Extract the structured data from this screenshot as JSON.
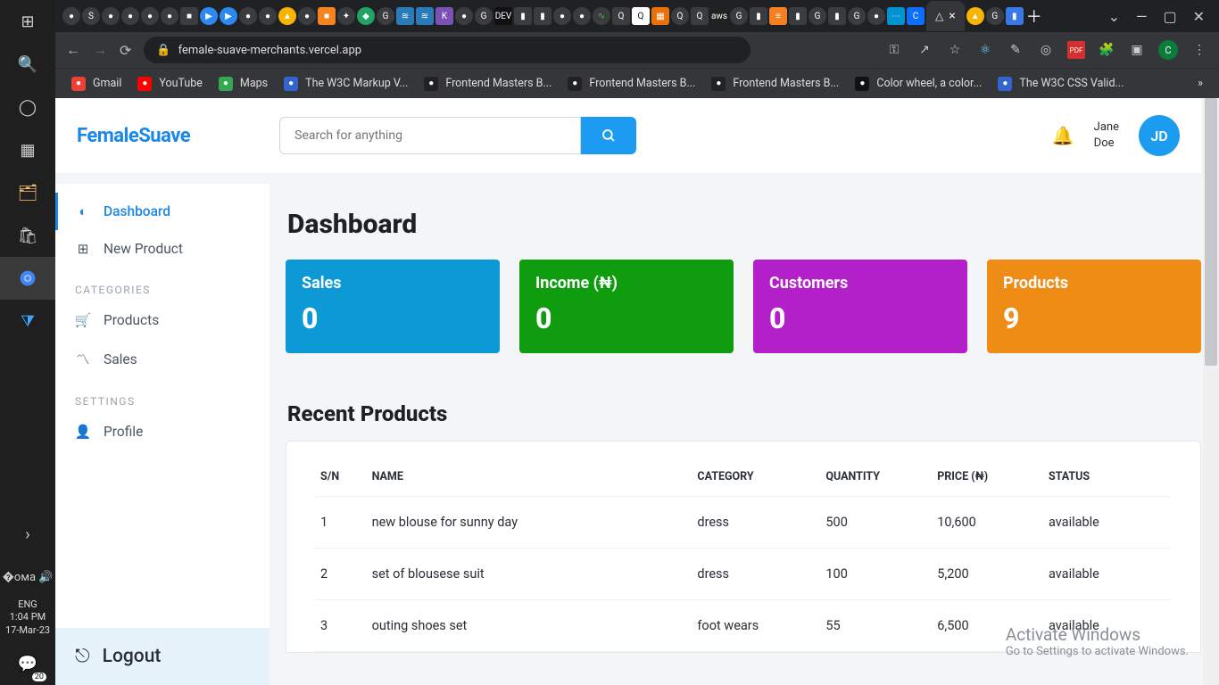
{
  "os": {
    "lang": "ENG",
    "time": "1:04 PM",
    "date": "17-Mar-23",
    "notif_badge": "20"
  },
  "browser": {
    "active_tab_title": "",
    "url": "female-suave-merchants.vercel.app",
    "profile_letter": "C",
    "bookmarks": [
      {
        "label": "Gmail",
        "color": "#ea4335"
      },
      {
        "label": "YouTube",
        "color": "#ff0000"
      },
      {
        "label": "Maps",
        "color": "#34a853"
      },
      {
        "label": "The W3C Markup V...",
        "color": "#3366cc"
      },
      {
        "label": "Frontend Masters B...",
        "color": "#222"
      },
      {
        "label": "Frontend Masters B...",
        "color": "#222"
      },
      {
        "label": "Frontend Masters B...",
        "color": "#222"
      },
      {
        "label": "Color wheel, a color...",
        "color": "#111"
      },
      {
        "label": "The W3C CSS Valid...",
        "color": "#3366cc"
      }
    ]
  },
  "app": {
    "logo": "FemaleSuave",
    "search_placeholder": "Search for anything",
    "user_first": "Jane",
    "user_last": "Doe",
    "user_initials": "JD"
  },
  "sidebar": {
    "items_top": [
      {
        "icon": "◐",
        "label": "Dashboard",
        "active": true
      },
      {
        "icon": "⊞",
        "label": "New Product",
        "active": false
      }
    ],
    "head_categories": "CATEGORIES",
    "items_categories": [
      {
        "icon": "🛒",
        "label": "Products"
      },
      {
        "icon": "〽",
        "label": "Sales"
      }
    ],
    "head_settings": "SETTINGS",
    "items_settings": [
      {
        "icon": "👤",
        "label": "Profile"
      }
    ],
    "logout_label": "Logout"
  },
  "dashboard": {
    "title": "Dashboard",
    "cards": [
      {
        "label": "Sales",
        "value": "0",
        "class": "c-blue"
      },
      {
        "label": "Income (₦)",
        "value": "0",
        "class": "c-green"
      },
      {
        "label": "Customers",
        "value": "0",
        "class": "c-purple"
      },
      {
        "label": "Products",
        "value": "9",
        "class": "c-orange"
      }
    ],
    "recent_title": "Recent Products",
    "columns": [
      "S/N",
      "NAME",
      "CATEGORY",
      "QUANTITY",
      "PRICE (₦)",
      "STATUS"
    ],
    "rows": [
      {
        "sn": "1",
        "name": "new blouse for sunny day",
        "category": "dress",
        "qty": "500",
        "price": "10,600",
        "status": "available"
      },
      {
        "sn": "2",
        "name": "set of blousese suit",
        "category": "dress",
        "qty": "100",
        "price": "5,200",
        "status": "available"
      },
      {
        "sn": "3",
        "name": "outing shoes set",
        "category": "foot wears",
        "qty": "55",
        "price": "6,500",
        "status": "available"
      }
    ]
  },
  "watermark": {
    "line1": "Activate Windows",
    "line2": "Go to Settings to activate Windows."
  }
}
